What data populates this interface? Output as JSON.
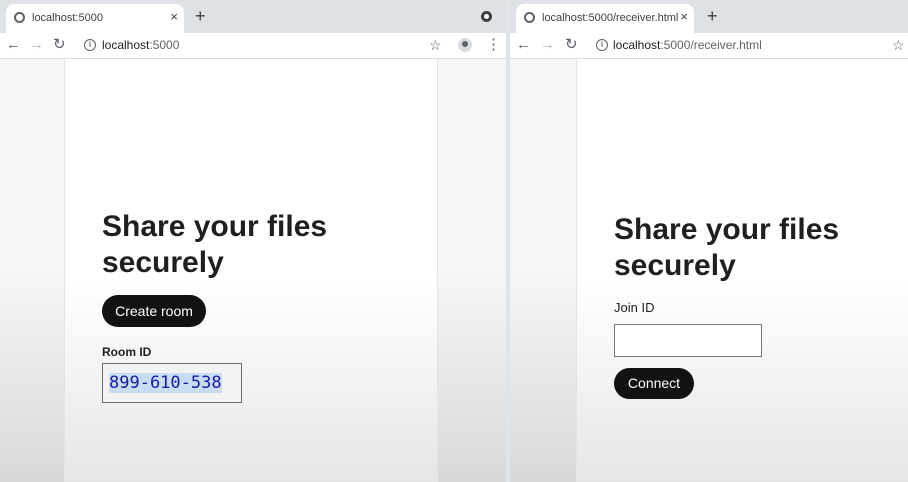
{
  "sender": {
    "tab_title": "localhost:5000",
    "url_host": "localhost",
    "url_rest": ":5000",
    "heading_line1": "Share your files",
    "heading_line2": "securely",
    "create_room_button": "Create room",
    "room_id_label": "Room ID",
    "room_id_value": "899-610-538"
  },
  "receiver": {
    "tab_title": "localhost:5000/receiver.html",
    "url_host": "localhost",
    "url_rest": ":5000/receiver.html",
    "heading_line1": "Share your files",
    "heading_line2": "securely",
    "join_id_label": "Join ID",
    "join_id_value": "",
    "connect_button": "Connect"
  },
  "chrome": {
    "tab_close": "×",
    "new_tab": "+",
    "back": "←",
    "forward": "→",
    "reload": "↻",
    "info": "i",
    "bookmark": "☆",
    "menu": "⋮"
  },
  "icons": {
    "favicon": "globe-icon",
    "recorder": "record-icon",
    "profile": "account-icon"
  }
}
